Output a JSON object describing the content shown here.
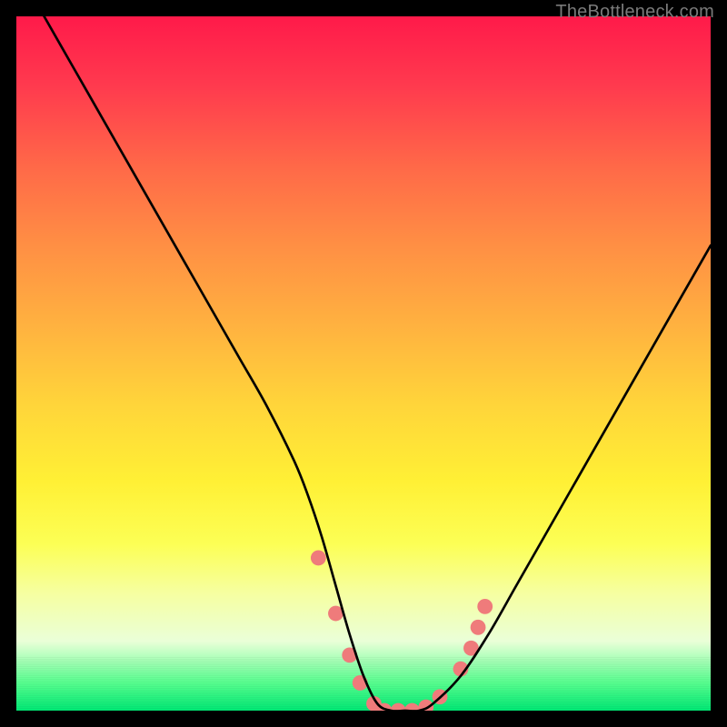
{
  "watermark": "TheBottleneck.com",
  "chart_data": {
    "type": "line",
    "title": "",
    "xlabel": "",
    "ylabel": "",
    "xlim": [
      0,
      100
    ],
    "ylim": [
      0,
      100
    ],
    "series": [
      {
        "name": "curve",
        "color": "#000000",
        "x": [
          4,
          8,
          12,
          16,
          20,
          24,
          28,
          32,
          36,
          40,
          42,
          44,
          46,
          48,
          50,
          52,
          54,
          56,
          58,
          60,
          64,
          68,
          72,
          76,
          80,
          84,
          88,
          92,
          96,
          100
        ],
        "y": [
          100,
          93,
          86,
          79,
          72,
          65,
          58,
          51,
          44,
          36,
          31,
          25,
          18,
          11,
          5,
          1,
          0,
          0,
          0,
          1,
          5,
          11,
          18,
          25,
          32,
          39,
          46,
          53,
          60,
          67
        ]
      }
    ],
    "markers": {
      "color": "#ef7b7b",
      "points": [
        {
          "x": 43.5,
          "y": 22
        },
        {
          "x": 46.0,
          "y": 14
        },
        {
          "x": 48.0,
          "y": 8
        },
        {
          "x": 49.5,
          "y": 4
        },
        {
          "x": 51.5,
          "y": 1
        },
        {
          "x": 53.0,
          "y": 0
        },
        {
          "x": 55.0,
          "y": 0
        },
        {
          "x": 57.0,
          "y": 0
        },
        {
          "x": 59.0,
          "y": 0.5
        },
        {
          "x": 61.0,
          "y": 2
        },
        {
          "x": 64.0,
          "y": 6
        },
        {
          "x": 65.5,
          "y": 9
        },
        {
          "x": 66.5,
          "y": 12
        },
        {
          "x": 67.5,
          "y": 15
        }
      ],
      "radius_pct": 1.1
    }
  }
}
